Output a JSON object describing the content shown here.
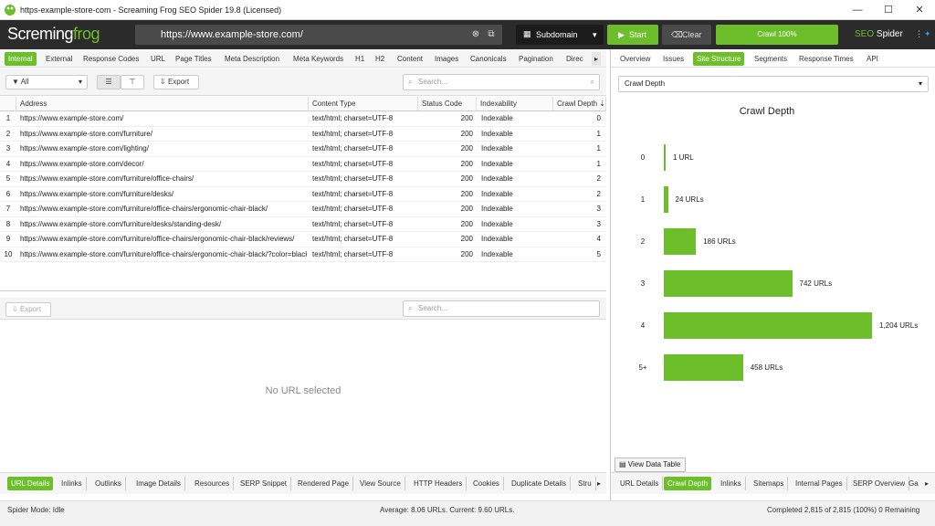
{
  "window": {
    "title": "https-example-store-com - Screaming Frog SEO Spider 19.8 (Licensed)",
    "minimize": "—",
    "maximize": "☐",
    "close": "✕"
  },
  "header": {
    "brand_prefix": "Scre",
    "brand_mid": "ming",
    "brand_suffix": "frog",
    "url": "https://www.example-store.com/",
    "mode": "Subdomain",
    "start": "Start",
    "clear": "Clear",
    "progress": "Crawl 100%",
    "progress_value": 1.0,
    "seo": "SEO",
    "spider": " Spider"
  },
  "tabs": [
    "Internal",
    "External",
    "Response Codes",
    "URL",
    "Page Titles",
    "Meta Description",
    "Meta Keywords",
    "H1",
    "H2",
    "Content",
    "Images",
    "Canonicals",
    "Pagination",
    "Direc"
  ],
  "toolbar": {
    "filter": "All",
    "export": "Export",
    "search_placeholder": "Search..."
  },
  "table": {
    "columns": [
      "Address",
      "Content Type",
      "Status Code",
      "Indexability",
      "Crawl Depth"
    ],
    "rows": [
      [
        "1",
        "https://www.example-store.com/",
        "text/html; charset=UTF-8",
        "200",
        "Indexable",
        "0"
      ],
      [
        "2",
        "https://www.example-store.com/furniture/",
        "text/html; charset=UTF-8",
        "200",
        "Indexable",
        "1"
      ],
      [
        "3",
        "https://www.example-store.com/lighting/",
        "text/html; charset=UTF-8",
        "200",
        "Indexable",
        "1"
      ],
      [
        "4",
        "https://www.example-store.com/decor/",
        "text/html; charset=UTF-8",
        "200",
        "Indexable",
        "1"
      ],
      [
        "5",
        "https://www.example-store.com/furniture/office-chairs/",
        "text/html; charset=UTF-8",
        "200",
        "Indexable",
        "2"
      ],
      [
        "6",
        "https://www.example-store.com/furniture/desks/",
        "text/html; charset=UTF-8",
        "200",
        "Indexable",
        "2"
      ],
      [
        "7",
        "https://www.example-store.com/furniture/office-chairs/ergonomic-chair-black/",
        "text/html; charset=UTF-8",
        "200",
        "Indexable",
        "3"
      ],
      [
        "8",
        "https://www.example-store.com/furniture/desks/standing-desk/",
        "text/html; charset=UTF-8",
        "200",
        "Indexable",
        "3"
      ],
      [
        "9",
        "https://www.example-store.com/furniture/office-chairs/ergonomic-chair-black/reviews/",
        "text/html; charset=UTF-8",
        "200",
        "Indexable",
        "4"
      ],
      [
        "10",
        "https://www.example-store.com/furniture/office-chairs/ergonomic-chair-black/?color=black",
        "text/html; charset=UTF-8",
        "200",
        "Indexable",
        "5"
      ]
    ]
  },
  "lower": {
    "export": "Export",
    "search_placeholder": "Search...",
    "empty": "No URL selected"
  },
  "bottom_tabs": [
    "URL Details",
    "Inlinks",
    "Outlinks",
    "Image Details",
    "Resources",
    "SERP Snippet",
    "Rendered Page",
    "View Source",
    "HTTP Headers",
    "Cookies",
    "Duplicate Details",
    "Stru"
  ],
  "right": {
    "tabs": [
      "Overview",
      "Issues",
      "Site Structure",
      "Segments",
      "Response Times",
      "API"
    ],
    "dropdown": "Crawl Depth",
    "view_table": "View Data Table",
    "bottom_tabs": [
      "URL Details",
      "Crawl Depth",
      "Inlinks",
      "Sitemaps",
      "Internal Pages",
      "SERP Overview",
      "Ga"
    ]
  },
  "chart_data": {
    "type": "bar",
    "orientation": "horizontal",
    "title": "Crawl Depth",
    "categories": [
      "0",
      "1",
      "2",
      "3",
      "4",
      "5+"
    ],
    "values": [
      1,
      24,
      186,
      742,
      1204,
      458
    ],
    "labels": [
      "1 URL",
      "24 URLs",
      "186 URLs",
      "742 URLs",
      "1,204 URLs",
      "458 URLs"
    ],
    "color": "#6cbf2b"
  },
  "status": {
    "mode": "Spider Mode: Idle",
    "average": "Average: 8.06 URLs. Current: 9.60 URLs.",
    "completed": "Completed 2,815 of 2,815 (100%) 0 Remaining"
  }
}
